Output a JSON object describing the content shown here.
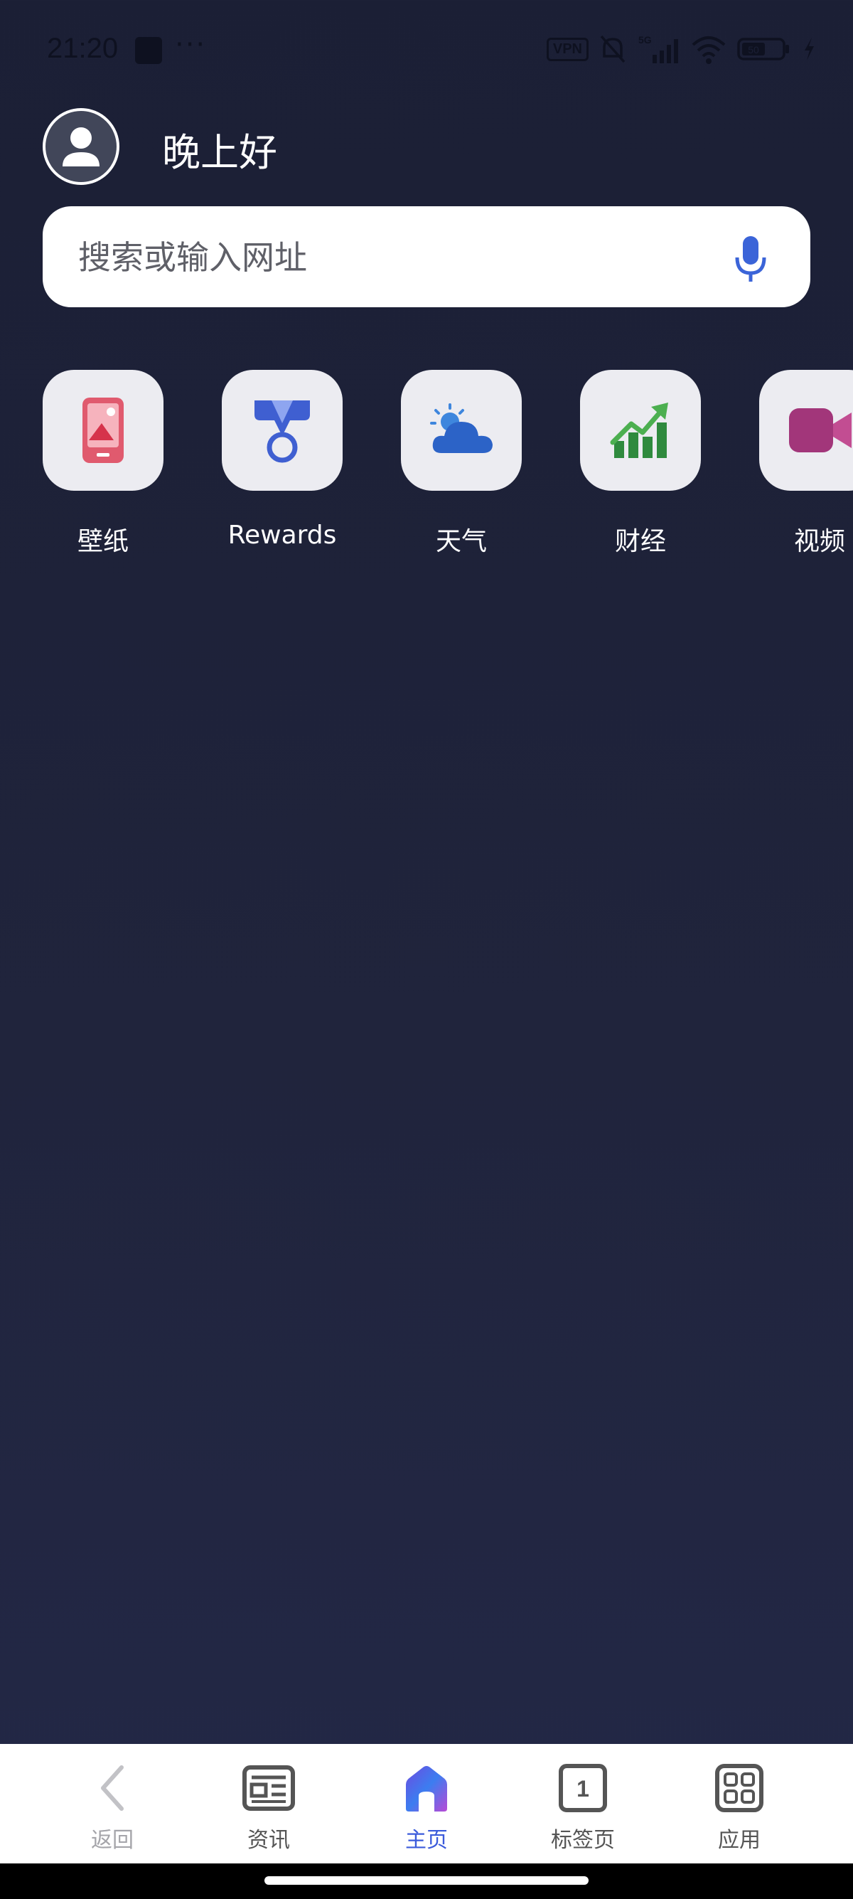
{
  "status_bar": {
    "time": "21:20",
    "more": "···",
    "vpn": "VPN",
    "network": "5G",
    "battery": "50"
  },
  "header": {
    "greeting": "晚上好"
  },
  "search": {
    "placeholder": "搜索或输入网址"
  },
  "shortcuts": [
    {
      "label": "壁纸",
      "icon": "wallpaper-icon"
    },
    {
      "label": "Rewards",
      "icon": "rewards-medal-icon"
    },
    {
      "label": "天气",
      "icon": "weather-icon"
    },
    {
      "label": "财经",
      "icon": "finance-chart-icon"
    },
    {
      "label": "视频",
      "icon": "video-camera-icon"
    }
  ],
  "bottom_nav": {
    "items": [
      {
        "label": "返回",
        "icon": "back-arrow-icon"
      },
      {
        "label": "资讯",
        "icon": "news-icon"
      },
      {
        "label": "主页",
        "icon": "home-icon"
      },
      {
        "label": "标签页",
        "icon": "tabs-icon",
        "count": "1"
      },
      {
        "label": "应用",
        "icon": "apps-grid-icon"
      }
    ],
    "active": "主页"
  },
  "colors": {
    "background": "#1f2339",
    "accent": "#3b5bdb"
  }
}
